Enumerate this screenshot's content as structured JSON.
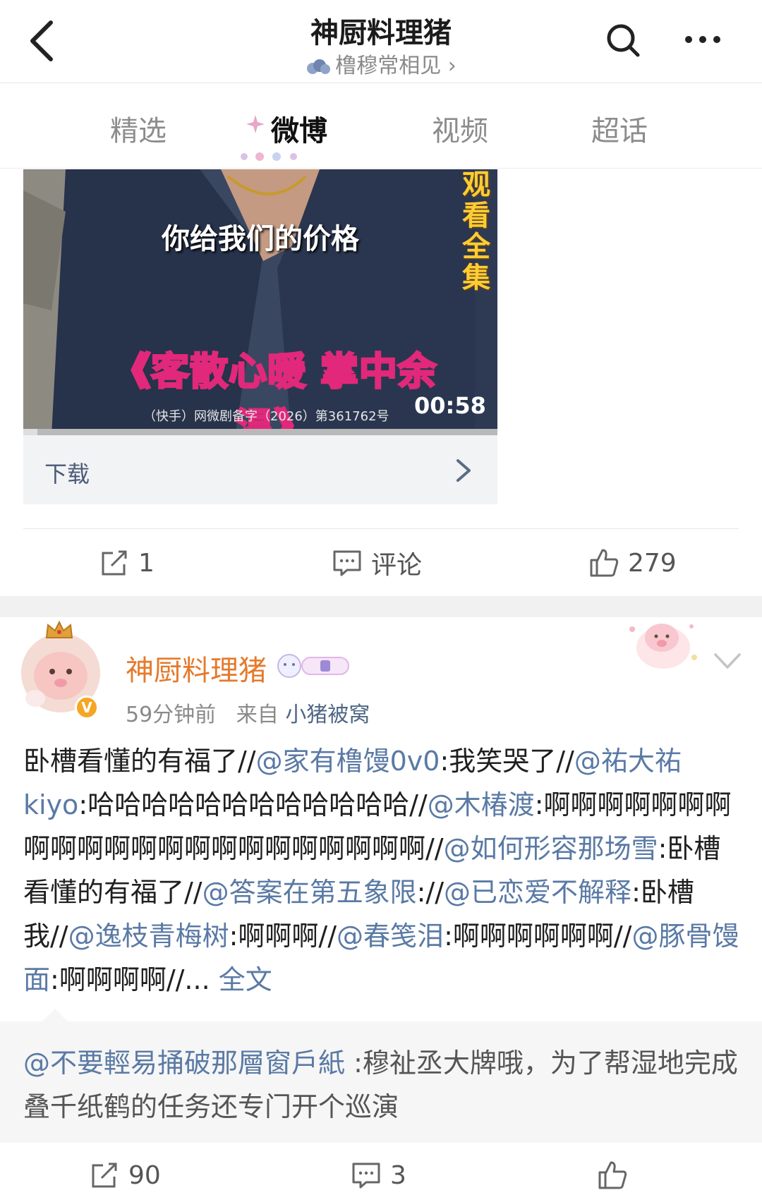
{
  "header": {
    "title": "神厨料理猪",
    "subtitle": "橹穆常相见 ›"
  },
  "tabs": [
    {
      "label": "精选"
    },
    {
      "label": "微博"
    },
    {
      "label": "视频"
    },
    {
      "label": "超话"
    }
  ],
  "video": {
    "caption": "你给我们的价格",
    "side_text": "观看全集",
    "banner": "《客散心暖 掌中余温》",
    "license": "（快手）网微剧备字（2026）第361762号",
    "duration": "00:58",
    "progress_fraction": 0.03
  },
  "download": {
    "label": "下载"
  },
  "post1_actions": {
    "repost_count": "1",
    "comment_label": "评论",
    "like_count": "279"
  },
  "post2": {
    "author": "神厨料理猪",
    "time": "59分钟前",
    "from_prefix": "来自",
    "source": "小猪被窝",
    "verified_badge": "V",
    "body": [
      {
        "t": "卧槽看懂的有福了//",
        "m": false
      },
      {
        "t": "@家有橹馒0v0",
        "m": true
      },
      {
        "t": ":我笑哭了//",
        "m": false
      },
      {
        "t": "@祐大祐kiyo",
        "m": true
      },
      {
        "t": ":哈哈哈哈哈哈哈哈哈哈哈哈//",
        "m": false
      },
      {
        "t": "@木椿渡",
        "m": true
      },
      {
        "t": ":啊啊啊啊啊啊啊啊啊啊啊啊啊啊啊啊啊啊啊啊啊啊//",
        "m": false
      },
      {
        "t": "@如何形容那场雪",
        "m": true
      },
      {
        "t": ":卧槽看懂的有福了//",
        "m": false
      },
      {
        "t": "@答案在第五象限",
        "m": true
      },
      {
        "t": "://",
        "m": false
      },
      {
        "t": "@已恋爱不解释",
        "m": true
      },
      {
        "t": ":卧槽我//",
        "m": false
      },
      {
        "t": "@逸枝青梅树",
        "m": true
      },
      {
        "t": ":啊啊啊//",
        "m": false
      },
      {
        "t": "@春笺泪",
        "m": true
      },
      {
        "t": ":啊啊啊啊啊啊//",
        "m": false
      },
      {
        "t": "@豚骨馒面",
        "m": true
      },
      {
        "t": ":啊啊啊啊//... ",
        "m": false
      },
      {
        "t": "全文",
        "m": true
      }
    ],
    "quote_mention": "@不要輕易捅破那層窗戶紙",
    "quote_text": " :穆祉丞大牌哦，为了帮湿地完成叠千纸鹤的任务还专门开个巡演",
    "repost_count": "90",
    "comment_count": "3"
  },
  "colors": {
    "mention": "#5a7aa5",
    "author": "#e57a2c",
    "accent_pink": "#e2287a"
  }
}
